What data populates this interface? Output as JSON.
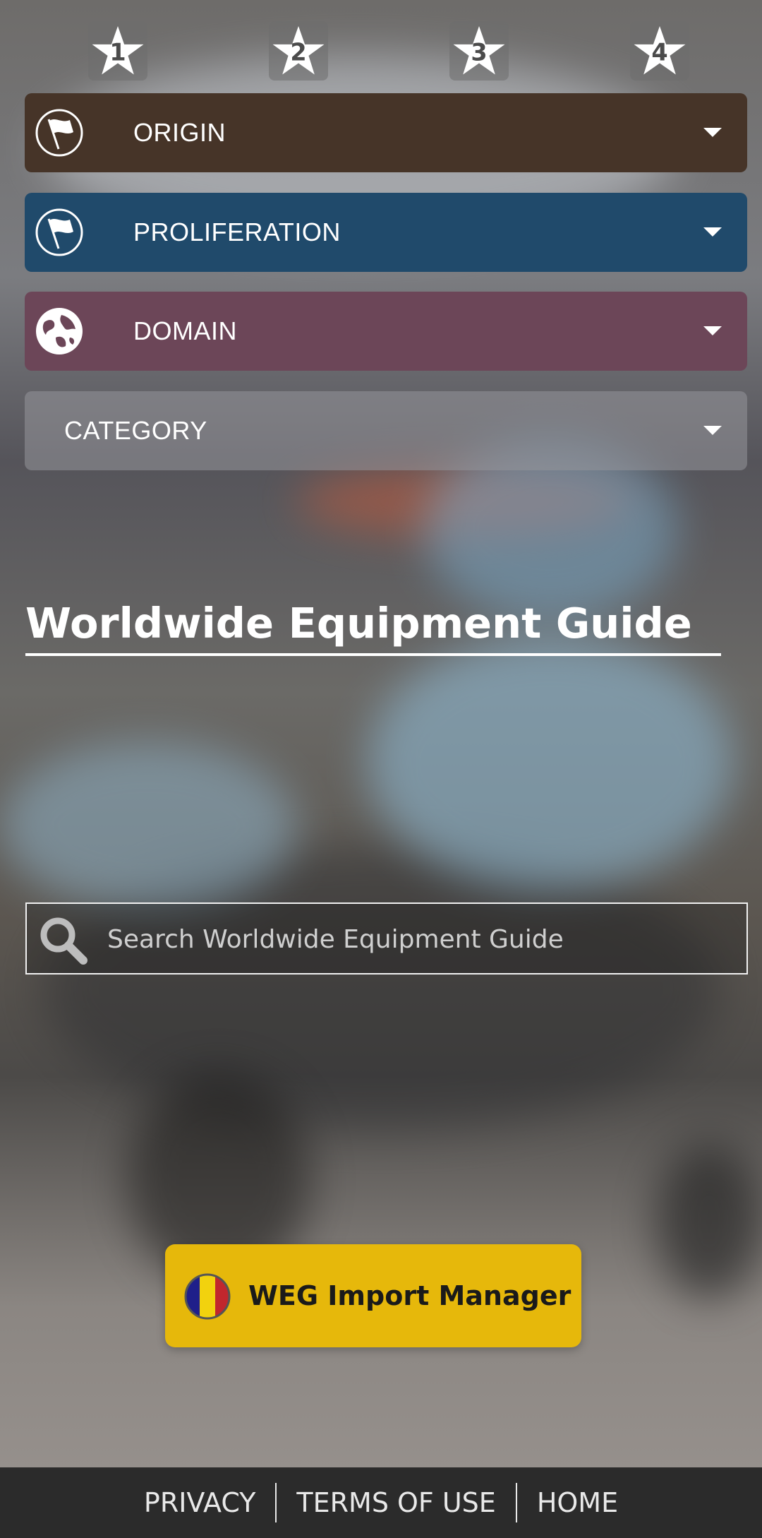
{
  "stars": [
    {
      "number": "1"
    },
    {
      "number": "2"
    },
    {
      "number": "3"
    },
    {
      "number": "4"
    }
  ],
  "filters": {
    "origin": {
      "label": "ORIGIN",
      "icon": "flag-icon",
      "color": "#463428"
    },
    "proliferation": {
      "label": "PROLIFERATION",
      "icon": "flag-icon",
      "color": "#204a6b"
    },
    "domain": {
      "label": "DOMAIN",
      "icon": "globe-icon",
      "color": "#6c4658"
    },
    "category": {
      "label": "CATEGORY",
      "color": "#96969b"
    }
  },
  "title": "Worldwide Equipment Guide",
  "search": {
    "placeholder": "Search Worldwide Equipment Guide",
    "value": "",
    "icon": "search-icon"
  },
  "import_button": {
    "label": "WEG Import Manager",
    "color": "#e6b80b",
    "emblem_colors": [
      "#1f1f8a",
      "#f2d20e",
      "#c1272d"
    ]
  },
  "footer": {
    "privacy": "PRIVACY",
    "terms": "TERMS OF USE",
    "home": "HOME"
  }
}
